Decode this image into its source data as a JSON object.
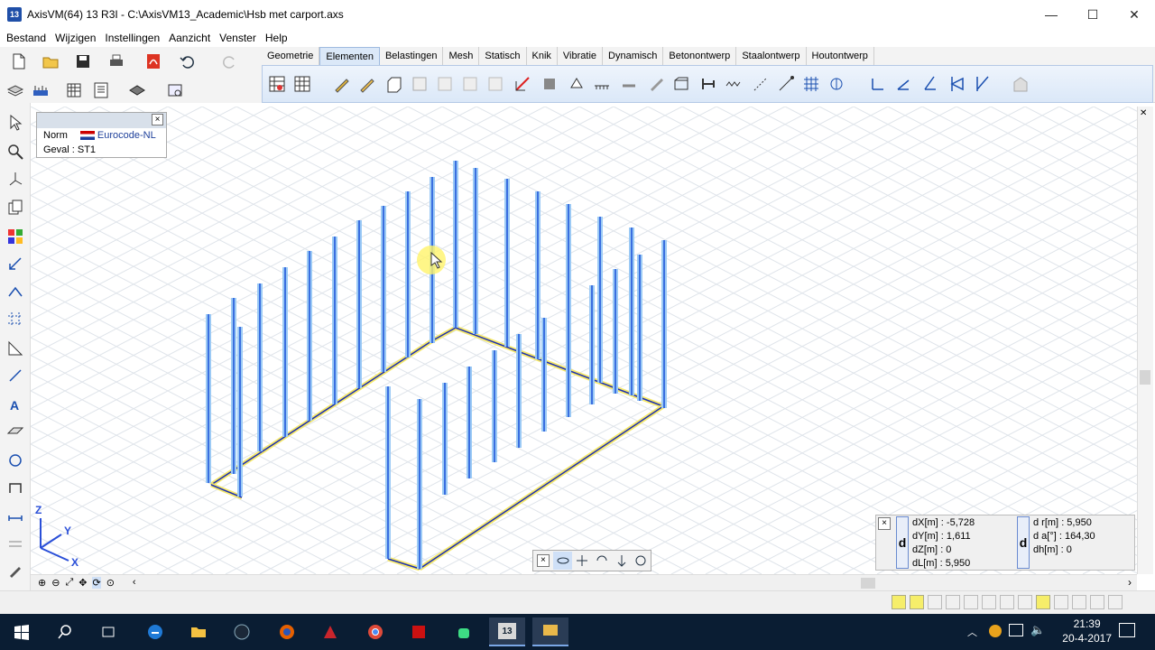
{
  "window": {
    "app_icon_text": "13",
    "title": "AxisVM(64) 13 R3I - C:\\AxisVM13_Academic\\Hsb met carport.axs",
    "minimize": "—",
    "maximize": "☐",
    "close": "✕"
  },
  "menu": {
    "items": [
      "Bestand",
      "Wijzigen",
      "Instellingen",
      "Aanzicht",
      "Venster",
      "Help"
    ]
  },
  "tabs": {
    "items": [
      "Geometrie",
      "Elementen",
      "Belastingen",
      "Mesh",
      "Statisch",
      "Knik",
      "Vibratie",
      "Dynamisch",
      "Betonontwerp",
      "Staalontwerp",
      "Houtontwerp"
    ],
    "active_index": 1
  },
  "infobox": {
    "close": "×",
    "norm_label": "Norm",
    "norm_value": "Eurocode-NL",
    "case_label": "Geval",
    "case_value": ": ST1"
  },
  "axes": {
    "z": "Z",
    "y": "Y",
    "x": "X"
  },
  "coords": {
    "close": "×",
    "d_label": "d",
    "left": [
      {
        "label": "dX[m]",
        "value": ": -5,728"
      },
      {
        "label": "dY[m]",
        "value": ": 1,611"
      },
      {
        "label": "dZ[m]",
        "value": ": 0"
      },
      {
        "label": "dL[m]",
        "value": ": 5,950"
      }
    ],
    "right": [
      {
        "label": "d r[m]",
        "value": ": 5,950"
      },
      {
        "label": "d a[°]",
        "value": ": 164,30"
      },
      {
        "label": "dh[m]",
        "value": ": 0"
      }
    ]
  },
  "navbar": {
    "close": "×"
  },
  "taskbar": {
    "time": "21:39",
    "date": "20-4-2017",
    "axis_icon_text": "13"
  },
  "colors": {
    "member_blue": "#3a6fe0",
    "member_light": "#9ccaf5",
    "support_yellow": "#f5e86a",
    "grid": "#dfe4ea",
    "taskbar": "#0a1d33"
  }
}
